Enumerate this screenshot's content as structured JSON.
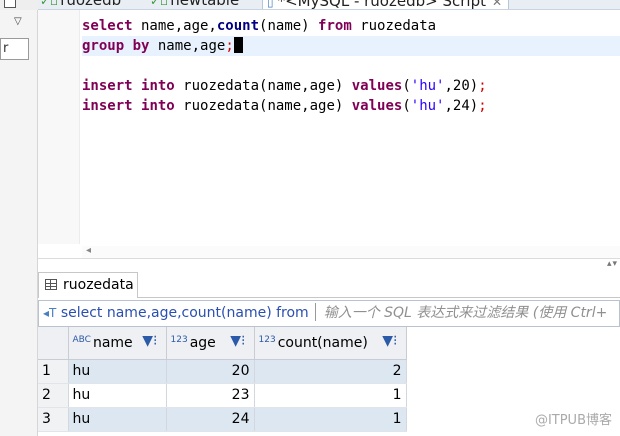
{
  "tabs": [
    {
      "label": "ruozedb",
      "icon": "sql-check-icon"
    },
    {
      "label": "newtable",
      "icon": "sql-check-icon"
    },
    {
      "label": "*<MySQL - ruozedb> Script",
      "icon": "sql-script-icon",
      "active": true
    }
  ],
  "left_panel": {
    "field_value": "r"
  },
  "editor": {
    "lines": [
      [
        {
          "t": "kw",
          "v": "select"
        },
        {
          "t": "plain",
          "v": " name,age,"
        },
        {
          "t": "fn",
          "v": "count"
        },
        {
          "t": "plain",
          "v": "(name) "
        },
        {
          "t": "kw",
          "v": "from"
        },
        {
          "t": "plain",
          "v": " ruozedata"
        }
      ],
      [
        {
          "t": "kw",
          "v": "group"
        },
        {
          "t": "plain",
          "v": " "
        },
        {
          "t": "kw",
          "v": "by"
        },
        {
          "t": "plain",
          "v": " name,age"
        },
        {
          "t": "semi",
          "v": ";"
        }
      ],
      [],
      [
        {
          "t": "kw",
          "v": "insert"
        },
        {
          "t": "plain",
          "v": " "
        },
        {
          "t": "kw",
          "v": "into"
        },
        {
          "t": "plain",
          "v": " ruozedata(name,age) "
        },
        {
          "t": "kw",
          "v": "values"
        },
        {
          "t": "plain",
          "v": "("
        },
        {
          "t": "str",
          "v": "'hu'"
        },
        {
          "t": "plain",
          "v": ","
        },
        {
          "t": "num",
          "v": "20"
        },
        {
          "t": "plain",
          "v": ")"
        },
        {
          "t": "semi",
          "v": ";"
        }
      ],
      [
        {
          "t": "kw",
          "v": "insert"
        },
        {
          "t": "plain",
          "v": " "
        },
        {
          "t": "kw",
          "v": "into"
        },
        {
          "t": "plain",
          "v": " ruozedata(name,age) "
        },
        {
          "t": "kw",
          "v": "values"
        },
        {
          "t": "plain",
          "v": "("
        },
        {
          "t": "str",
          "v": "'hu'"
        },
        {
          "t": "plain",
          "v": ","
        },
        {
          "t": "num",
          "v": "24"
        },
        {
          "t": "plain",
          "v": ")"
        },
        {
          "t": "semi",
          "v": ";"
        }
      ]
    ],
    "current_line": 1
  },
  "results": {
    "tab_label": "ruozedata",
    "filter_query": "select name,age,count(name) from",
    "filter_placeholder": "输入一个 SQL 表达式来过滤结果 (使用 Ctrl+",
    "columns": [
      {
        "name": "name",
        "type_icon": "ABC"
      },
      {
        "name": "age",
        "type_icon": "123"
      },
      {
        "name": "count(name)",
        "type_icon": "123"
      }
    ],
    "rows": [
      {
        "rn": "1",
        "cells": [
          "hu",
          "20",
          "2"
        ]
      },
      {
        "rn": "2",
        "cells": [
          "hu",
          "23",
          "1"
        ]
      },
      {
        "rn": "3",
        "cells": [
          "hu",
          "24",
          "1"
        ]
      }
    ]
  },
  "watermark": "@ITPUB博客",
  "colors": {
    "keyword": "#7f0055",
    "string": "#2a00ff",
    "semicolon": "#d00000",
    "current_line": "#e8f2fe",
    "row_highlight": "#dde7f2"
  }
}
